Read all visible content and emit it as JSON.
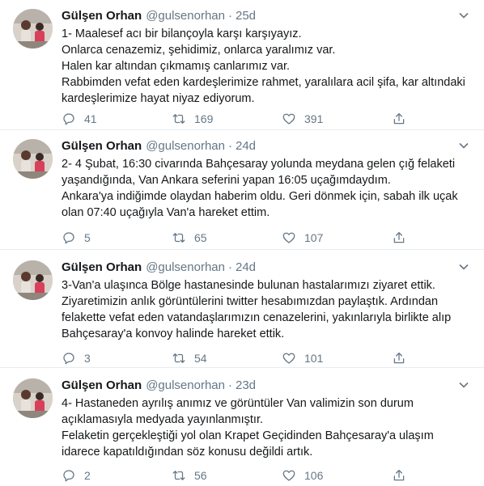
{
  "tweets": [
    {
      "name": "Gülşen Orhan",
      "handle": "@gulsenorhan",
      "separator": "·",
      "time": "25d",
      "lines": [
        "1- Maalesef acı bir bilançoyla karşı karşıyayız.",
        "Onlarca cenazemiz, şehidimiz, onlarca yaralımız var.",
        "Halen kar altından çıkmamış canlarımız var.",
        "Rabbimden vefat eden kardeşlerimize rahmet, yaralılara acil şifa, kar altındaki",
        "kardeşlerimize hayat niyaz ediyorum."
      ],
      "replies": "41",
      "retweets": "169",
      "likes": "391"
    },
    {
      "name": "Gülşen Orhan",
      "handle": "@gulsenorhan",
      "separator": "·",
      "time": "24d",
      "lines": [
        "2- 4 Şubat, 16:30 civarında Bahçesaray yolunda meydana gelen çığ felaketi",
        "yaşandığında, Van Ankara seferini yapan 16:05 uçağımdaydım.",
        "Ankara'ya indiğimde olaydan haberim oldu. Geri dönmek için, sabah ilk uçak",
        "olan 07:40 uçağıyla Van'a hareket ettim."
      ],
      "replies": "5",
      "retweets": "65",
      "likes": "107"
    },
    {
      "name": "Gülşen Orhan",
      "handle": "@gulsenorhan",
      "separator": "·",
      "time": "24d",
      "lines": [
        "3-Van'a ulaşınca Bölge hastanesinde bulunan hastalarımızı ziyaret ettik.",
        "Ziyaretimizin anlık görüntülerini twitter hesabımızdan paylaştık. Ardından",
        "felakette vefat eden vatandaşlarımızın cenazelerini, yakınlarıyla birlikte alıp",
        "Bahçesaray'a konvoy halinde hareket ettik."
      ],
      "replies": "3",
      "retweets": "54",
      "likes": "101"
    },
    {
      "name": "Gülşen Orhan",
      "handle": "@gulsenorhan",
      "separator": "·",
      "time": "23d",
      "lines": [
        "4- Hastaneden ayrılış anımız ve görüntüler Van valimizin son durum",
        "açıklamasıyla medyada yayınlanmıştır.",
        "Felaketin gerçekleştiği yol olan Krapet Geçidinden Bahçesaray'a ulaşım",
        "idarece kapatıldığından söz konusu değildi artık."
      ],
      "replies": "2",
      "retweets": "56",
      "likes": "106"
    }
  ],
  "icons": {
    "reply": "reply-icon",
    "retweet": "retweet-icon",
    "like": "heart-icon",
    "share": "share-icon",
    "menu": "chevron-down-icon"
  },
  "colors": {
    "text": "#14171a",
    "muted": "#657786",
    "divider": "#e6ecf0"
  }
}
